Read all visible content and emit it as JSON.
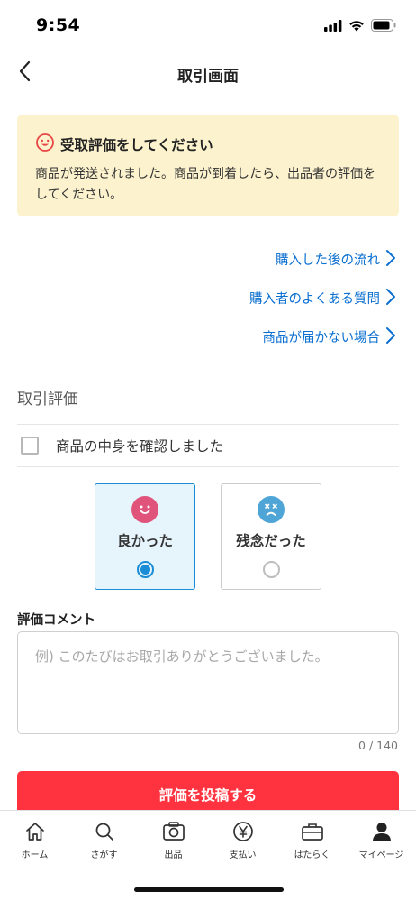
{
  "status_bar": {
    "time": "9:54"
  },
  "header": {
    "title": "取引画面"
  },
  "notice": {
    "title": "受取評価をしてください",
    "body": "商品が発送されました。商品が到着したら、出品者の評価をしてください。",
    "background": "#fcf2cd",
    "icon": "smile-icon"
  },
  "help_links": [
    {
      "label": "購入した後の流れ"
    },
    {
      "label": "購入者のよくある質問"
    },
    {
      "label": "商品が届かない場合"
    }
  ],
  "evaluation": {
    "section_title": "取引評価",
    "confirm_label": "商品の中身を確認しました",
    "confirm_checked": false,
    "options": [
      {
        "label": "良かった",
        "selected": true,
        "icon": "happy-face-icon",
        "color": "#e0547c"
      },
      {
        "label": "残念だった",
        "selected": false,
        "icon": "sad-face-icon",
        "color": "#4fa5d6"
      }
    ]
  },
  "comment": {
    "label": "評価コメント",
    "placeholder": "例) このたびはお取引ありがとうございました。",
    "value": "",
    "counter": "0 / 140"
  },
  "submit": {
    "label": "評価を投稿する",
    "color": "#ff333f"
  },
  "tab_bar": {
    "items": [
      {
        "label": "ホーム",
        "icon": "home-icon"
      },
      {
        "label": "さがす",
        "icon": "search-icon"
      },
      {
        "label": "出品",
        "icon": "camera-icon"
      },
      {
        "label": "支払い",
        "icon": "yen-icon"
      },
      {
        "label": "はたらく",
        "icon": "briefcase-icon"
      },
      {
        "label": "マイページ",
        "icon": "person-icon"
      }
    ]
  },
  "colors": {
    "accent": "#1b8cd6",
    "link": "#0a6fd1",
    "primary": "#ff333f"
  }
}
